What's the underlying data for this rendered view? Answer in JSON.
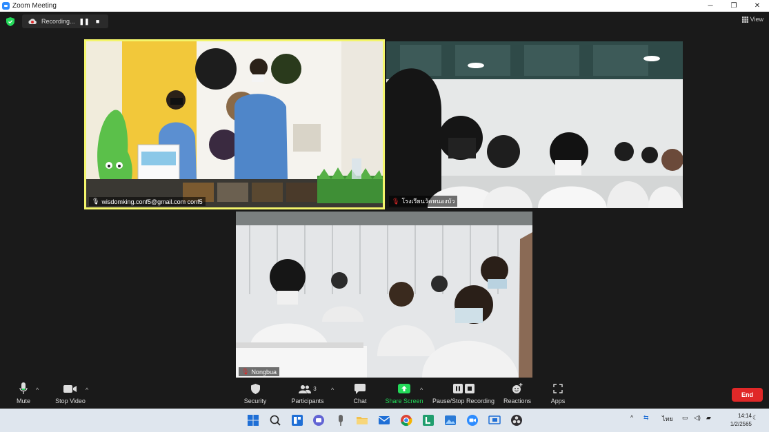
{
  "window": {
    "title": "Zoom Meeting",
    "controls": [
      "─",
      "❐",
      "✕"
    ]
  },
  "topbar": {
    "recording_label": "Recording...",
    "pause_symbol": "❚❚",
    "stop_symbol": "■",
    "view_label": "View"
  },
  "tiles": [
    {
      "name": "wisdomking.conf5@gmail.com conf5",
      "muted": false
    },
    {
      "name": "โรงเรียนวัดหนองบัว",
      "muted": true
    },
    {
      "name": "Nongbua",
      "muted": true
    }
  ],
  "toolbar": {
    "mute_label": "Mute",
    "stop_video_label": "Stop Video",
    "security_label": "Security",
    "participants_label": "Participants",
    "participants_count": "3",
    "chat_label": "Chat",
    "share_screen_label": "Share Screen",
    "pause_stop_recording_label": "Pause/Stop Recording",
    "reactions_label": "Reactions",
    "apps_label": "Apps",
    "end_label": "End"
  },
  "taskbar": {
    "language": "ไทย",
    "time": "14:14",
    "date": "1/2/2565"
  },
  "colors": {
    "accent": "#2d8cff",
    "share_green": "#23d959",
    "end_red": "#e02828",
    "active_border": "#f3f56b"
  }
}
